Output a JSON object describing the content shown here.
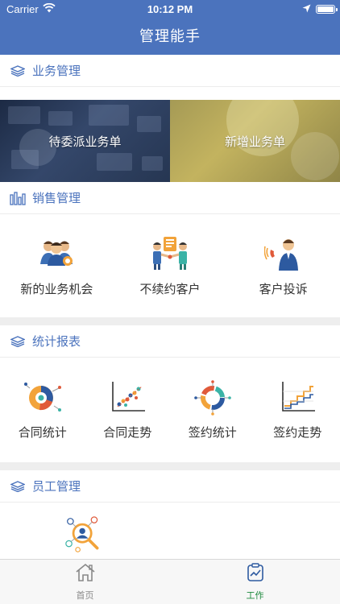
{
  "status_bar": {
    "carrier": "Carrier",
    "time": "10:12 PM"
  },
  "nav": {
    "title": "管理能手"
  },
  "sections": {
    "business": {
      "title": "业务管理",
      "banners": [
        {
          "label": "待委派业务单"
        },
        {
          "label": "新增业务单"
        }
      ]
    },
    "sales": {
      "title": "销售管理",
      "items": [
        {
          "label": "新的业务机会",
          "icon": "team-icon"
        },
        {
          "label": "不续约客户",
          "icon": "handshake-icon"
        },
        {
          "label": "客户投诉",
          "icon": "phone-call-icon"
        }
      ]
    },
    "stats": {
      "title": "统计报表",
      "items": [
        {
          "label": "合同统计",
          "icon": "pie-chart-icon"
        },
        {
          "label": "合同走势",
          "icon": "scatter-chart-icon"
        },
        {
          "label": "签约统计",
          "icon": "radial-chart-icon"
        },
        {
          "label": "签约走势",
          "icon": "step-chart-icon"
        }
      ]
    },
    "staff": {
      "title": "员工管理",
      "items": [
        {
          "label": "",
          "icon": "staff-search-icon"
        }
      ]
    }
  },
  "tabbar": {
    "tabs": [
      {
        "label": "首页",
        "icon": "home-icon",
        "active": false
      },
      {
        "label": "工作",
        "icon": "work-icon",
        "active": true
      }
    ]
  },
  "colors": {
    "primary": "#4b73bd",
    "active_tab": "#1e8a3e",
    "text": "#333333"
  }
}
